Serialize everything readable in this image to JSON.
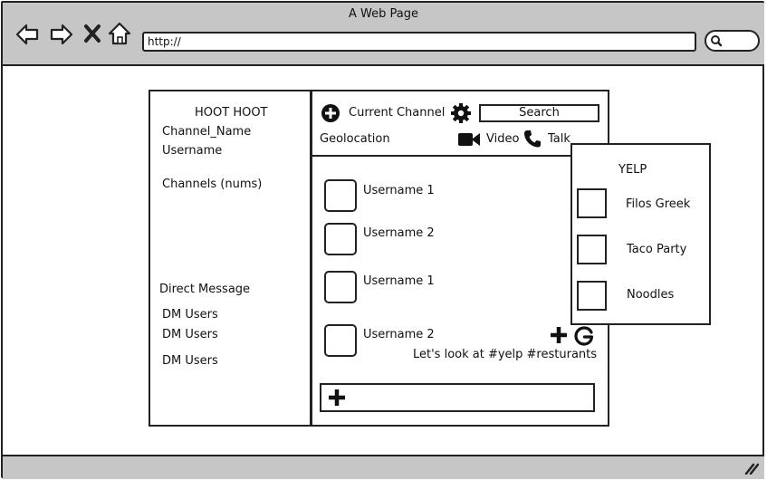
{
  "browser": {
    "window_title": "A Web Page",
    "url": "http://"
  },
  "sidebar": {
    "app_title": "HOOT HOOT",
    "channel_name": "Channel_Name",
    "username": "Username",
    "channels_label": "Channels (nums)",
    "direct_message_label": "Direct Message",
    "dm_users": [
      "DM Users",
      "DM Users",
      "DM Users"
    ]
  },
  "header": {
    "current_channel": "Current Channel",
    "search_label": "Search",
    "geolocation": "Geolocation",
    "video_label": "Video",
    "talk_label": "Talk"
  },
  "messages": [
    {
      "username": "Username 1"
    },
    {
      "username": "Username 2"
    },
    {
      "username": "Username 1"
    },
    {
      "username": "Username 2",
      "text": "Let's look at #yelp #resturants"
    }
  ],
  "yelp_panel": {
    "title": "YELP",
    "items": [
      "Filos Greek",
      "Taco Party",
      "Noodles"
    ]
  },
  "icons": {
    "back": "back-arrow-icon",
    "forward": "forward-arrow-icon",
    "close": "close-icon",
    "home": "home-icon",
    "search": "search-icon",
    "add_channel": "plus-circle-icon",
    "settings": "gear-icon",
    "video": "video-camera-icon",
    "phone": "phone-icon",
    "plus": "plus-icon",
    "google": "google-icon",
    "resize": "resize-grip-icon"
  }
}
